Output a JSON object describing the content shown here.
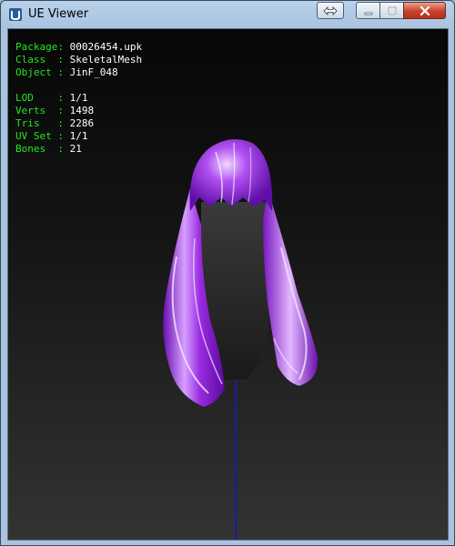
{
  "window": {
    "title": "UE Viewer"
  },
  "info": {
    "package": {
      "label": "Package:",
      "value": "00026454.upk"
    },
    "class": {
      "label": "Class  :",
      "value": "SkeletalMesh"
    },
    "object": {
      "label": "Object :",
      "value": "JinF_048"
    },
    "lod": {
      "label": "LOD    :",
      "value": "1/1"
    },
    "verts": {
      "label": "Verts  :",
      "value": "1498"
    },
    "tris": {
      "label": "Tris   :",
      "value": "2286"
    },
    "uvset": {
      "label": "UV Set :",
      "value": "1/1"
    },
    "bones": {
      "label": "Bones  :",
      "value": "21"
    }
  },
  "colors": {
    "label": "#22e822",
    "value": "#ffffff",
    "hair": "#a020e8",
    "bone_axis": "#1a1aa8"
  }
}
